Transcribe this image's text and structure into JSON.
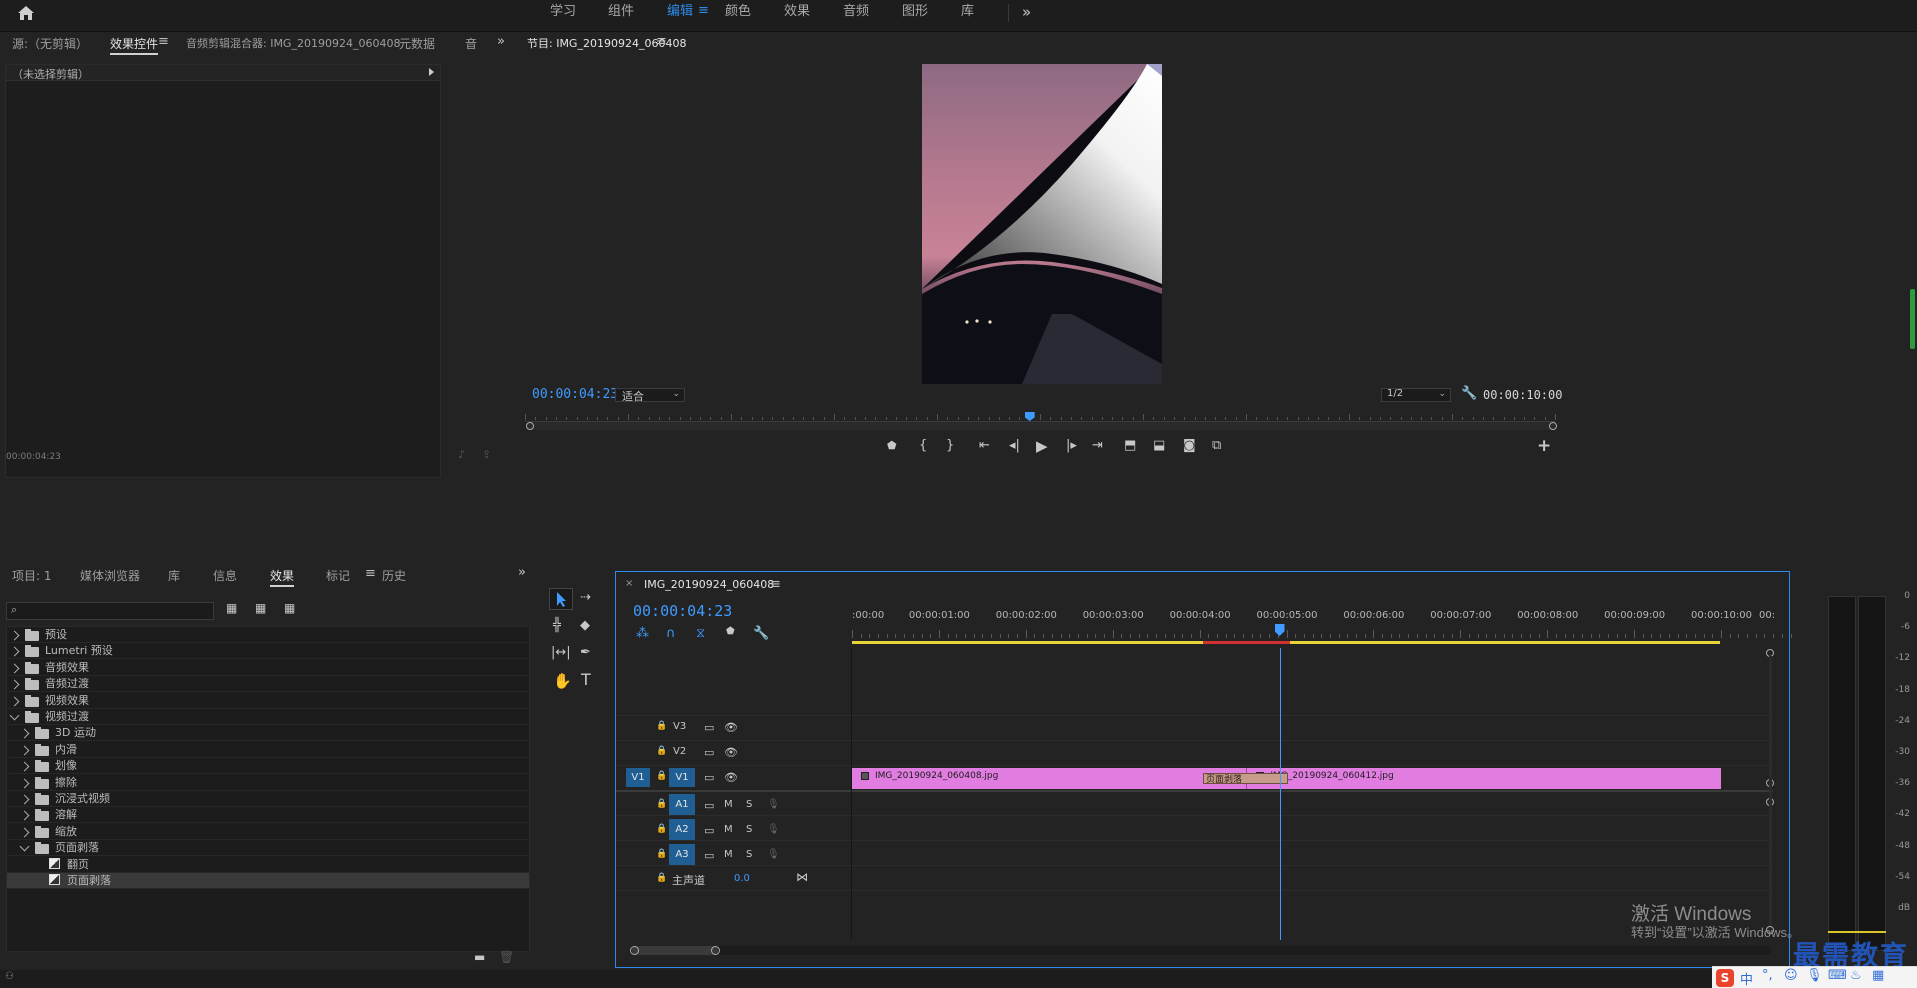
{
  "workspaces": {
    "tabs": [
      "学习",
      "组件",
      "编辑",
      "颜色",
      "效果",
      "音频",
      "图形",
      "库"
    ],
    "active": "编辑",
    "more": "»"
  },
  "source_panel": {
    "tabs": [
      "源:（无剪辑）",
      "效果控件",
      "音频剪辑混合器: IMG_20190924_060408",
      "元数据",
      "音"
    ],
    "active_tab": "效果控件",
    "no_clip": "（未选择剪辑）",
    "timecode": "00:00:04:23"
  },
  "program_monitor": {
    "title": "节目: IMG_20190924_060408",
    "timecode": "00:00:04:23",
    "fit": "适合",
    "resolution": "1/2",
    "duration": "00:00:10:00",
    "playhead_fraction": 0.49
  },
  "project_panel": {
    "tabs": [
      "项目: 1",
      "媒体浏览器",
      "库",
      "信息",
      "效果",
      "标记",
      "历史"
    ],
    "active_tab": "效果",
    "search_placeholder": "",
    "tree": [
      {
        "label": "预设",
        "depth": 0,
        "expanded": false,
        "icon": "preset-folder"
      },
      {
        "label": "Lumetri 预设",
        "depth": 0,
        "expanded": false,
        "icon": "preset-folder"
      },
      {
        "label": "音频效果",
        "depth": 0,
        "expanded": false,
        "icon": "folder"
      },
      {
        "label": "音频过渡",
        "depth": 0,
        "expanded": false,
        "icon": "folder"
      },
      {
        "label": "视频效果",
        "depth": 0,
        "expanded": false,
        "icon": "folder"
      },
      {
        "label": "视频过渡",
        "depth": 0,
        "expanded": true,
        "icon": "folder"
      },
      {
        "label": "3D 运动",
        "depth": 1,
        "expanded": false,
        "icon": "folder"
      },
      {
        "label": "内滑",
        "depth": 1,
        "expanded": false,
        "icon": "folder"
      },
      {
        "label": "划像",
        "depth": 1,
        "expanded": false,
        "icon": "folder"
      },
      {
        "label": "擦除",
        "depth": 1,
        "expanded": false,
        "icon": "folder"
      },
      {
        "label": "沉浸式视频",
        "depth": 1,
        "expanded": false,
        "icon": "folder"
      },
      {
        "label": "溶解",
        "depth": 1,
        "expanded": false,
        "icon": "folder"
      },
      {
        "label": "缩放",
        "depth": 1,
        "expanded": false,
        "icon": "folder"
      },
      {
        "label": "页面剥落",
        "depth": 1,
        "expanded": true,
        "icon": "folder"
      },
      {
        "label": "翻页",
        "depth": 2,
        "icon": "transition"
      },
      {
        "label": "页面剥落",
        "depth": 2,
        "icon": "transition",
        "selected": true
      }
    ]
  },
  "timeline": {
    "sequence_name": "IMG_20190924_060408",
    "timecode": "00:00:04:23",
    "ruler": [
      ":00:00",
      "00:00:01:00",
      "00:00:02:00",
      "00:00:03:00",
      "00:00:04:00",
      "00:00:05:00",
      "00:00:06:00",
      "00:00:07:00",
      "00:00:08:00",
      "00:00:09:00",
      "00:00:10:00",
      "00:"
    ],
    "video_tracks": [
      {
        "name": "V3"
      },
      {
        "name": "V2"
      },
      {
        "name": "V1",
        "source": "V1"
      }
    ],
    "audio_tracks": [
      {
        "name": "A1",
        "m": "M",
        "s": "S"
      },
      {
        "name": "A2",
        "m": "M",
        "s": "S"
      },
      {
        "name": "A3",
        "m": "M",
        "s": "S"
      }
    ],
    "master": {
      "label": "主声道",
      "value": "0.0"
    },
    "clips": [
      {
        "name": "IMG_20190924_060408.jpg",
        "start": 0,
        "end": 4.55
      },
      {
        "name": "IMG_20190924_060412.jpg",
        "start": 4.55,
        "end": 10
      }
    ],
    "transition": {
      "name": "页面剥落",
      "start": 4.5,
      "end": 5.5
    }
  },
  "meter": {
    "scale": [
      "0",
      "-6",
      "-12",
      "-18",
      "-24",
      "-30",
      "-36",
      "-42",
      "-48",
      "-54",
      "dB"
    ]
  },
  "watermark": {
    "activate_title": "激活 Windows",
    "activate_sub": "转到“设置”以激活 Windows。",
    "brand": "最需教育"
  },
  "ime": {
    "label": "中"
  },
  "colors": {
    "accent": "#2d8ceb",
    "clip": "#e17de0",
    "transition": "#c89c8a",
    "track_active": "#1f5f93"
  }
}
